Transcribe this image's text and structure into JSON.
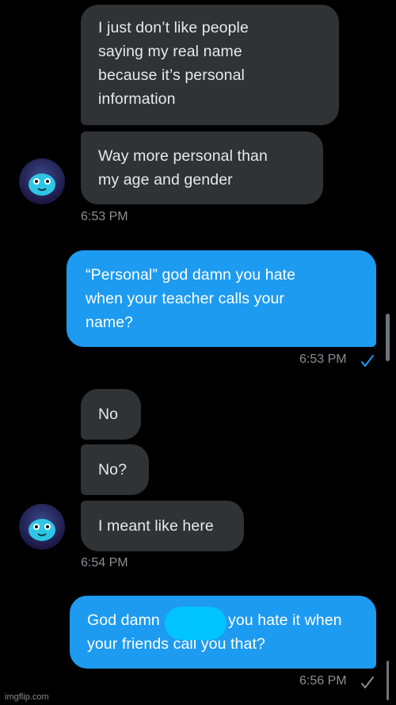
{
  "conversation": {
    "messages": [
      {
        "id": "m1",
        "text": "I just don’t like people\nsaying my real name\nbecause it’s personal\ninformation"
      },
      {
        "id": "m2",
        "text": "Way more personal than\nmy age and gender"
      },
      {
        "id": "m3",
        "text": "“Personal” god damn you hate\nwhen your teacher calls your\nname?"
      },
      {
        "id": "m4",
        "text": "No"
      },
      {
        "id": "m5",
        "text": "No?"
      },
      {
        "id": "m6",
        "text": "I meant like here"
      },
      {
        "id": "m7_part1",
        "text": "God damn"
      },
      {
        "id": "m7_part2",
        "text": "you hate it when"
      },
      {
        "id": "m7_line2",
        "text": "your friends call you that?"
      }
    ],
    "timestamps": {
      "t1": "6:53 PM",
      "t2": "6:53 PM",
      "t3": "6:54 PM",
      "t4": "6:56 PM"
    },
    "read_receipts": {
      "r1": "check-icon",
      "r2": "check-icon"
    }
  },
  "colors": {
    "background": "#000000",
    "incoming_bubble": "#2f3336",
    "outgoing_bubble": "#1d9bf0",
    "timestamp": "#8b8f93",
    "redaction": "#00c4ff",
    "read_check_blue": "#1d9bf0",
    "read_check_grey": "#8b8f93"
  },
  "watermark": "imgflip.com"
}
